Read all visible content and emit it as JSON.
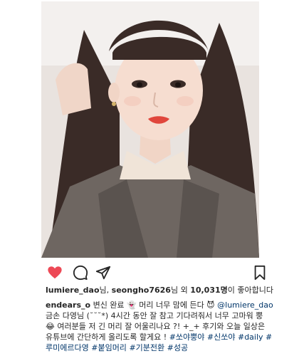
{
  "post": {
    "likes_line": {
      "user1": "lumiere_dao",
      "connector1": "님, ",
      "user2": "seongho7626",
      "connector2": "님 외 ",
      "count": "10,031명",
      "suffix": "이 좋아합니다"
    },
    "caption": {
      "username": "endears_o",
      "text1": " 변신 완료 👻 머리 너무 맘에 든다 😈 ",
      "mention": "@lumiere_dao",
      "text2": " 금손 다영님 (˘˘˘*) 4시간 동안 잘 참고 기다려줘서 너무 고마워 뿡 😂 여러분들 저 긴 머리 잘 어울리나요 ?! +_+ 후기와 오늘 일상은 유튜브에 간단하게 올리도록 할게요 ! ",
      "hashtags": [
        "#쏘야뿡야",
        "#신쏘야",
        "#daily",
        "#루미에르다영",
        "#붙임머리",
        "#기분전환",
        "#성공"
      ]
    },
    "icons": [
      "heart-icon",
      "comment-icon",
      "share-icon",
      "bookmark-icon"
    ],
    "colors": {
      "like": "#ed4956",
      "link": "#003569",
      "text": "#262626"
    }
  }
}
